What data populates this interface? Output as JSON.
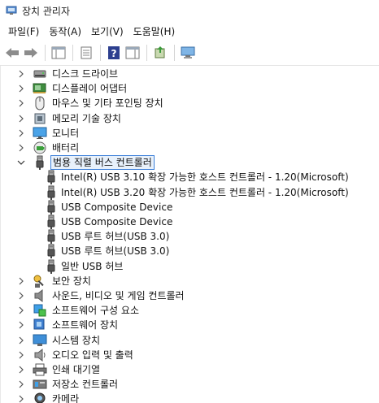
{
  "window": {
    "title": "장치 관리자"
  },
  "menu": [
    "파일(F)",
    "동작(A)",
    "보기(V)",
    "도움말(H)"
  ],
  "toolbar": [
    {
      "name": "back-button",
      "icon": "arrow-left-icon"
    },
    {
      "name": "forward-button",
      "icon": "arrow-right-icon"
    },
    {
      "sep": true
    },
    {
      "name": "show-hide-console-tree-button",
      "icon": "console-tree-icon"
    },
    {
      "sep": true
    },
    {
      "name": "properties-button",
      "icon": "properties-icon"
    },
    {
      "sep": true
    },
    {
      "name": "help-button",
      "icon": "help-icon"
    },
    {
      "name": "action-pane-button",
      "icon": "action-pane-icon"
    },
    {
      "sep": true
    },
    {
      "name": "update-driver-button",
      "icon": "update-driver-icon"
    },
    {
      "sep": true
    },
    {
      "name": "scan-hardware-button",
      "icon": "monitor-scan-icon"
    }
  ],
  "tree": {
    "items": [
      {
        "label": "디스크 드라이브",
        "icon": "disk-icon",
        "expander": "collapsed"
      },
      {
        "label": "디스플레이 어댑터",
        "icon": "display-adapter-icon",
        "expander": "collapsed"
      },
      {
        "label": "마우스 및 기타 포인팅 장치",
        "icon": "mouse-icon",
        "expander": "collapsed"
      },
      {
        "label": "메모리 기술 장치",
        "icon": "memory-icon",
        "expander": "collapsed"
      },
      {
        "label": "모니터",
        "icon": "monitor-icon",
        "expander": "collapsed"
      },
      {
        "label": "배터리",
        "icon": "battery-icon",
        "expander": "collapsed"
      },
      {
        "label": "범용 직렬 버스 컨트롤러",
        "icon": "usb-icon",
        "expander": "expanded",
        "selected": true
      },
      {
        "label": "Intel(R) USB 3.10 확장 가능한 호스트 컨트롤러 - 1.20(Microsoft)",
        "icon": "usb-icon",
        "child": true
      },
      {
        "label": "Intel(R) USB 3.20 확장 가능한 호스트 컨트롤러 - 1.20(Microsoft)",
        "icon": "usb-icon",
        "child": true
      },
      {
        "label": "USB Composite Device",
        "icon": "usb-icon",
        "child": true
      },
      {
        "label": "USB Composite Device",
        "icon": "usb-icon",
        "child": true
      },
      {
        "label": "USB 루트 허브(USB 3.0)",
        "icon": "usb-icon",
        "child": true
      },
      {
        "label": "USB 루트 허브(USB 3.0)",
        "icon": "usb-icon",
        "child": true
      },
      {
        "label": "일반 USB 허브",
        "icon": "usb-icon",
        "child": true
      },
      {
        "label": "보안 장치",
        "icon": "security-key-icon",
        "expander": "collapsed"
      },
      {
        "label": "사운드, 비디오 및 게임 컨트롤러",
        "icon": "speaker-icon",
        "expander": "collapsed"
      },
      {
        "label": "소프트웨어 구성 요소",
        "icon": "software-component-icon",
        "expander": "collapsed"
      },
      {
        "label": "소프트웨어 장치",
        "icon": "software-device-icon",
        "expander": "collapsed"
      },
      {
        "label": "시스템 장치",
        "icon": "system-device-icon",
        "expander": "collapsed"
      },
      {
        "label": "오디오 입력 및 출력",
        "icon": "audio-icon",
        "expander": "collapsed"
      },
      {
        "label": "인쇄 대기열",
        "icon": "printer-icon",
        "expander": "collapsed"
      },
      {
        "label": "저장소 컨트롤러",
        "icon": "storage-controller-icon",
        "expander": "collapsed"
      },
      {
        "label": "카메라",
        "icon": "camera-icon",
        "expander": "collapsed"
      }
    ]
  }
}
